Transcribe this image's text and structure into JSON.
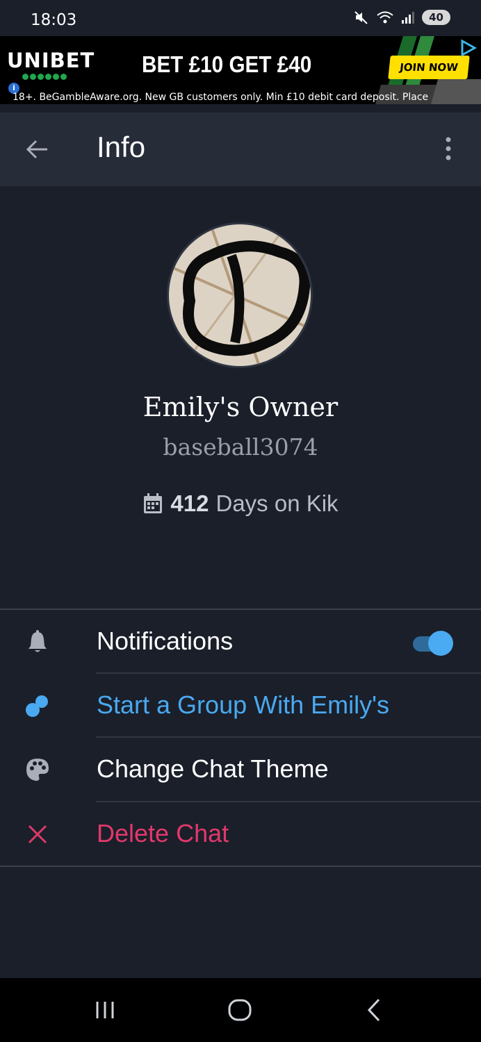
{
  "status_bar": {
    "time": "18:03",
    "battery": "40"
  },
  "ad": {
    "brand": "UNIBET",
    "headline": "BET £10 GET £40",
    "cta": "JOIN NOW",
    "disclaimer": "18+. BeGambleAware.org. New GB customers only. Min £10 debit card deposit. Place"
  },
  "app_bar": {
    "title": "Info"
  },
  "profile": {
    "display_name": "Emily's Owner",
    "username": "baseball3074",
    "days_count": "412",
    "days_suffix": "Days on Kik"
  },
  "menu": {
    "notifications": {
      "label": "Notifications",
      "enabled": true
    },
    "start_group": {
      "label": "Start a Group With Emily's"
    },
    "change_theme": {
      "label": "Change Chat Theme"
    },
    "delete_chat": {
      "label": "Delete Chat"
    }
  },
  "colors": {
    "background": "#1a1f2a",
    "app_bar": "#262c38",
    "accent_blue": "#4aa9f0",
    "danger_red": "#e2386b"
  }
}
